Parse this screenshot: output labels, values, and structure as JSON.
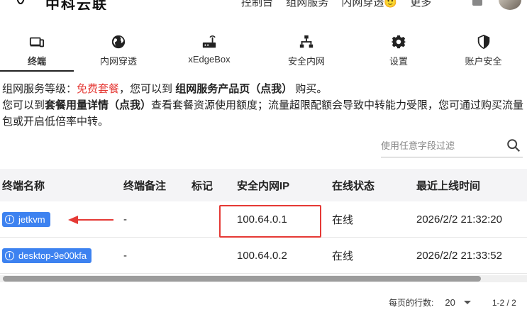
{
  "header": {
    "brand": "中科云联",
    "links": [
      "控制台",
      "组网服务",
      "内网穿透🙂",
      "更多"
    ]
  },
  "tabs": [
    {
      "label": "终端",
      "icon": "terminal-icon",
      "active": true
    },
    {
      "label": "内网穿透",
      "icon": "globe-icon"
    },
    {
      "label": "xEdgeBox",
      "icon": "router-icon"
    },
    {
      "label": "安全内网",
      "icon": "network-icon"
    },
    {
      "label": "设置",
      "icon": "gear-icon"
    },
    {
      "label": "账户安全",
      "icon": "shield-icon"
    }
  ],
  "info": {
    "line1_prefix": "组网服务等级：",
    "plan": "免费套餐",
    "line1_mid": "，您可以到",
    "product_link": "组网服务产品页（点我）",
    "line1_suffix": "购买。",
    "line2_prefix": "您可以到",
    "usage_link": "套餐用量详情（点我）",
    "line2_rest": "查看套餐资源使用额度；流量超限配额会导致中转能力受限，您可通过购买流量包或开启低倍率中转。"
  },
  "filter": {
    "placeholder": "使用任意字段过滤"
  },
  "table": {
    "columns": [
      "终端名称",
      "终端备注",
      "标记",
      "安全内网IP",
      "在线状态",
      "最近上线时间"
    ],
    "rows": [
      {
        "name": "jetkvm",
        "remark": "-",
        "tag": "",
        "ip": "100.64.0.1",
        "status": "在线",
        "last_online": "2026/2/2 21:32:20"
      },
      {
        "name": "desktop-9e00kfa",
        "remark": "-",
        "tag": "",
        "ip": "100.64.0.2",
        "status": "在线",
        "last_online": "2026/2/2 21:33:52"
      }
    ]
  },
  "pagination": {
    "rows_label": "每页的行数:",
    "rows_per_page": "20",
    "range": "1-2 / 2"
  },
  "colors": {
    "accent": "#3d82f0",
    "highlight": "#e53935"
  }
}
